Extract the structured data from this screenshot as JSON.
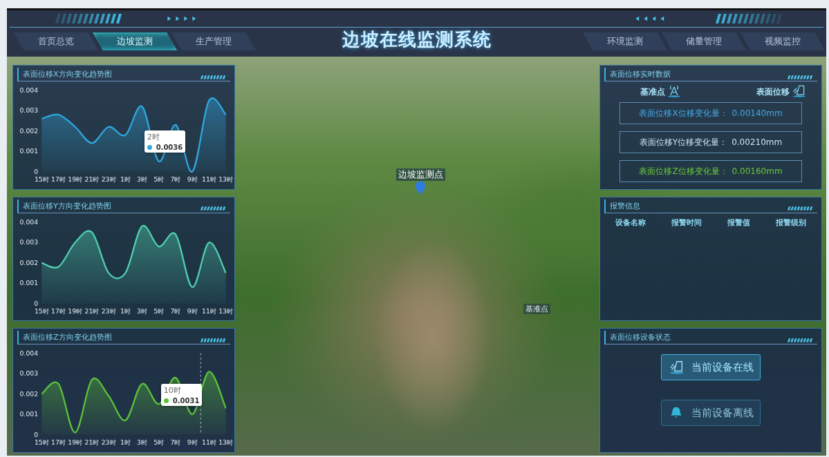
{
  "header": {
    "title": "边坡在线监测系统",
    "tabs_left": [
      {
        "label": "首页总览",
        "selected": false
      },
      {
        "label": "边坡监测",
        "selected": true
      },
      {
        "label": "生产管理",
        "selected": false
      }
    ],
    "tabs_right": [
      {
        "label": "环境监测",
        "selected": false
      },
      {
        "label": "储量管理",
        "selected": false
      },
      {
        "label": "视频监控",
        "selected": false
      }
    ]
  },
  "charts": [
    {
      "title": "表面位移X方向变化趋势图",
      "tooltip": {
        "label": "2时",
        "value": "0.0036"
      },
      "chart_data": {
        "type": "area",
        "categories": [
          "15时",
          "17时",
          "19时",
          "21时",
          "23时",
          "1时",
          "3时",
          "5时",
          "7时",
          "9时",
          "11时",
          "13时"
        ],
        "series": [
          {
            "color": "#2fa8e0",
            "values": [
              0.0026,
              0.0028,
              0.0022,
              0.0014,
              0.0022,
              0.0018,
              0.0032,
              0.0005,
              0.0023,
              0.0,
              0.0035,
              0.0028
            ]
          }
        ],
        "ylim": [
          0,
          0.004
        ],
        "yticks": [
          0,
          0.001,
          0.002,
          0.003,
          0.004
        ]
      }
    },
    {
      "title": "表面位移Y方向变化趋势图",
      "chart_data": {
        "type": "area",
        "categories": [
          "15时",
          "17时",
          "19时",
          "21时",
          "23时",
          "1时",
          "3时",
          "5时",
          "7时",
          "9时",
          "11时",
          "13时"
        ],
        "series": [
          {
            "color": "#4fd1b0",
            "values": [
              0.002,
              0.0018,
              0.003,
              0.0035,
              0.0015,
              0.0015,
              0.0038,
              0.0028,
              0.0034,
              0.0008,
              0.003,
              0.0015
            ]
          }
        ],
        "ylim": [
          0,
          0.004
        ],
        "yticks": [
          0,
          0.001,
          0.002,
          0.003,
          0.004
        ]
      }
    },
    {
      "title": "表面位移Z方向变化趋势图",
      "tooltip": {
        "label": "10时",
        "value": "0.0031"
      },
      "chart_data": {
        "type": "area",
        "categories": [
          "15时",
          "17时",
          "19时",
          "21时",
          "23时",
          "1时",
          "3时",
          "5时",
          "7时",
          "9时",
          "11时",
          "13时"
        ],
        "series": [
          {
            "color": "#5cc23a",
            "values": [
              0.002,
              0.0025,
              0.0001,
              0.0027,
              0.0019,
              0.0007,
              0.0025,
              0.0015,
              0.0028,
              0.001,
              0.0031,
              0.0013
            ]
          }
        ],
        "ylim": [
          0,
          0.004
        ],
        "yticks": [
          0,
          0.001,
          0.002,
          0.003,
          0.004
        ]
      }
    }
  ],
  "map": {
    "markers": [
      {
        "label": "边坡监测点",
        "kind": "monitor"
      },
      {
        "label": "基准点",
        "kind": "reference"
      }
    ]
  },
  "realtime": {
    "title": "表面位移实时数据",
    "legend": [
      {
        "label": "基准点",
        "kind": "antenna"
      },
      {
        "label": "表面位移",
        "kind": "displacement"
      }
    ],
    "readings": [
      {
        "label": "表面位移X位移变化量：",
        "value": "0.00140mm",
        "color": "#44a8e6"
      },
      {
        "label": "表面位移Y位移变化量：",
        "value": "0.00210mm",
        "color": "#cde4f4"
      },
      {
        "label": "表面位移Z位移变化量：",
        "value": "0.00160mm",
        "color": "#6cc83c"
      }
    ]
  },
  "alarm": {
    "title": "报警信息",
    "columns": [
      "设备名称",
      "报警时间",
      "报警值",
      "报警级别"
    ]
  },
  "device_status": {
    "title": "表面位移设备状态",
    "states": [
      {
        "label": "当前设备在线",
        "kind": "online",
        "active": true
      },
      {
        "label": "当前设备离线",
        "kind": "offline",
        "active": false
      }
    ]
  }
}
